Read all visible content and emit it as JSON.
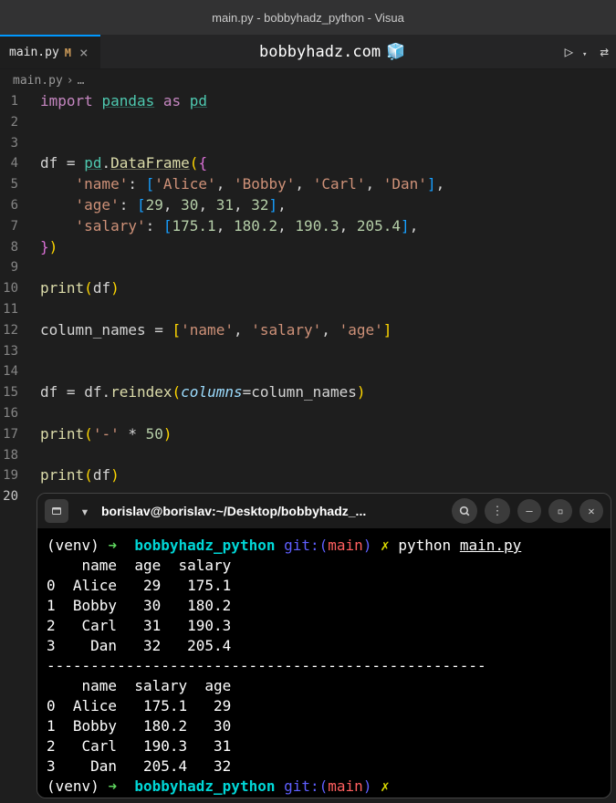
{
  "window_title": "main.py - bobbyhadz_python - Visua",
  "site_label": "bobbyhadz.com",
  "tab": {
    "filename": "main.py",
    "modified_indicator": "M"
  },
  "breadcrumb": {
    "file": "main.py",
    "sep": "›",
    "rest": "…"
  },
  "code_lines": [
    "import pandas as pd",
    "",
    "",
    "df = pd.DataFrame({",
    "    'name': ['Alice', 'Bobby', 'Carl', 'Dan'],",
    "    'age': [29, 30, 31, 32],",
    "    'salary': [175.1, 180.2, 190.3, 205.4],",
    "})",
    "",
    "print(df)",
    "",
    "column_names = ['name', 'salary', 'age']",
    "",
    "",
    "df = df.reindex(columns=column_names)",
    "",
    "print('-' * 50)",
    "",
    "print(df)",
    ""
  ],
  "terminal": {
    "title": "borislav@borislav:~/Desktop/bobbyhadz_...",
    "env": "(venv)",
    "arrow": "➜",
    "dir": "bobbyhadz_python",
    "git_label": "git:(",
    "branch": "main",
    "git_close": ")",
    "x": "✗",
    "cmd": "python",
    "cmd_file": "main.py",
    "output1_header": "    name  age  salary",
    "output1_rows": [
      "0  Alice   29   175.1",
      "1  Bobby   30   180.2",
      "2   Carl   31   190.3",
      "3    Dan   32   205.4"
    ],
    "divider": "--------------------------------------------------",
    "output2_header": "    name  salary  age",
    "output2_rows": [
      "0  Alice   175.1   29",
      "1  Bobby   180.2   30",
      "2   Carl   190.3   31",
      "3    Dan   205.4   32"
    ]
  }
}
